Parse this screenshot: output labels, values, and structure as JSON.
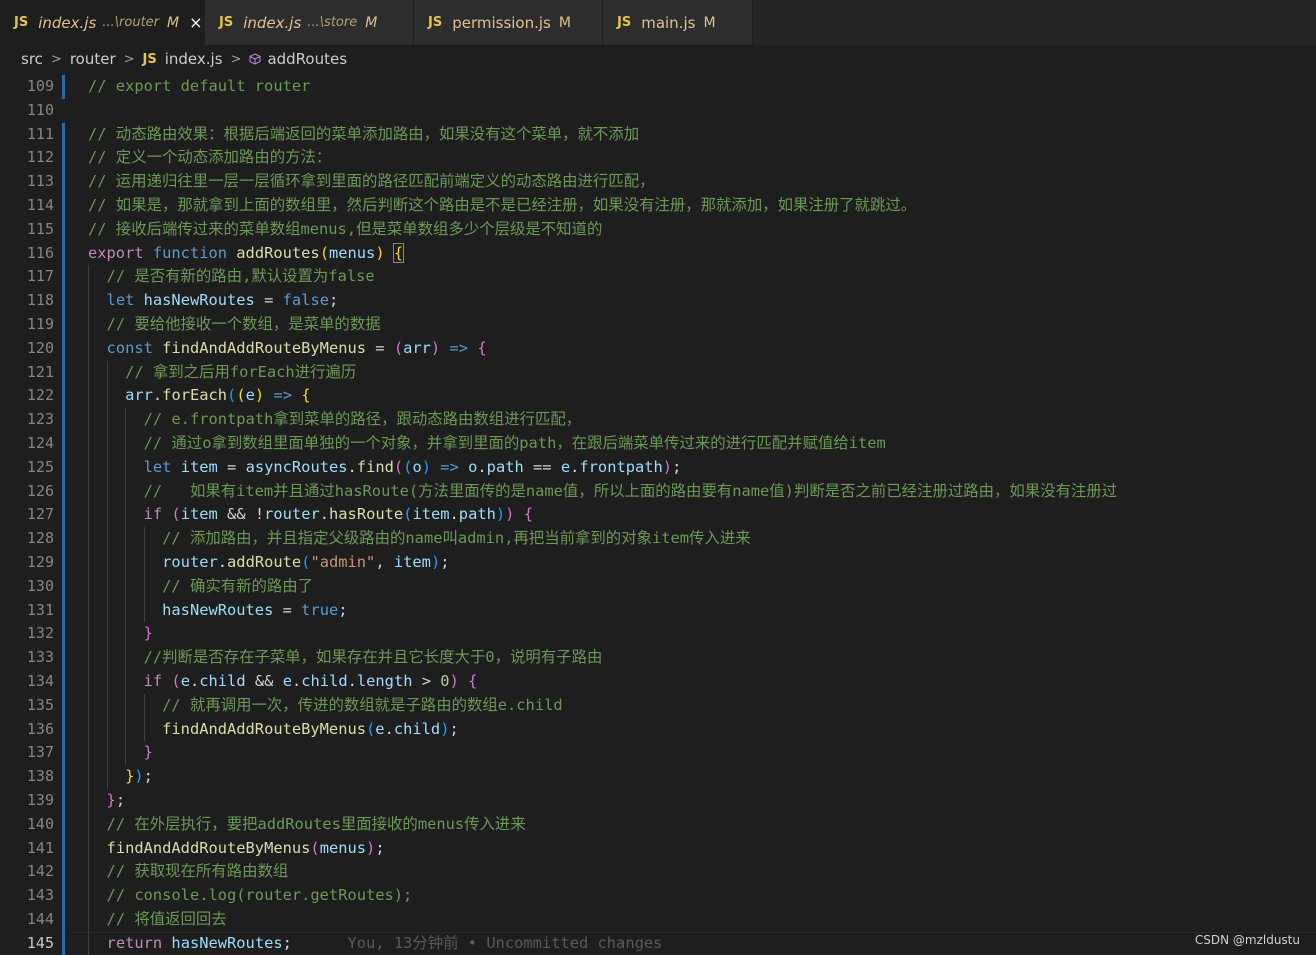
{
  "tabs": [
    {
      "icon": "JS",
      "name": "index.js",
      "path": "...\\router",
      "badge": "M",
      "close": "×",
      "active": true,
      "italic": true
    },
    {
      "icon": "JS",
      "name": "index.js",
      "path": "...\\store",
      "badge": "M",
      "active": false,
      "italic": true
    },
    {
      "icon": "JS",
      "name": "permission.js",
      "path": "",
      "badge": "M",
      "active": false,
      "italic": false
    },
    {
      "icon": "JS",
      "name": "main.js",
      "path": "",
      "badge": "M",
      "active": false,
      "italic": false
    }
  ],
  "breadcrumb": {
    "src": "src",
    "router": "router",
    "js_icon": "JS",
    "file": "index.js",
    "symbol": "addRoutes"
  },
  "lines": [
    {
      "n": "109",
      "t": [
        [
          "c",
          "// export default router"
        ]
      ]
    },
    {
      "n": "110",
      "t": []
    },
    {
      "n": "111",
      "t": [
        [
          "c",
          "// 动态路由效果：根据后端返回的菜单添加路由，如果没有这个菜单，就不添加"
        ]
      ]
    },
    {
      "n": "112",
      "t": [
        [
          "c",
          "// 定义一个动态添加路由的方法："
        ]
      ]
    },
    {
      "n": "113",
      "t": [
        [
          "c",
          "// 运用递归往里一层一层循环拿到里面的路径匹配前端定义的动态路由进行匹配，"
        ]
      ]
    },
    {
      "n": "114",
      "t": [
        [
          "c",
          "// 如果是，那就拿到上面的数组里，然后判断这个路由是不是已经注册，如果没有注册，那就添加，如果注册了就跳过。"
        ]
      ]
    },
    {
      "n": "115",
      "t": [
        [
          "c",
          "// 接收后端传过来的菜单数组menus,但是菜单数组多少个层级是不知道的"
        ]
      ]
    },
    {
      "n": "116",
      "t": [
        [
          "k",
          "export "
        ],
        [
          "s",
          "function "
        ],
        [
          "f",
          "addRoutes"
        ],
        [
          "b1",
          "("
        ],
        [
          "v",
          "menus"
        ],
        [
          "b1",
          ")"
        ],
        [
          "p",
          " "
        ],
        [
          "b1 bracket-box",
          "{"
        ]
      ]
    },
    {
      "n": "117",
      "t": [
        [
          "p",
          "  "
        ],
        [
          "c",
          "// 是否有新的路由,默认设置为false"
        ]
      ]
    },
    {
      "n": "118",
      "t": [
        [
          "p",
          "  "
        ],
        [
          "s",
          "let "
        ],
        [
          "v",
          "hasNewRoutes"
        ],
        [
          "p",
          " = "
        ],
        [
          "s",
          "false"
        ],
        [
          "p",
          ";"
        ]
      ]
    },
    {
      "n": "119",
      "t": [
        [
          "p",
          "  "
        ],
        [
          "c",
          "// 要给他接收一个数组，是菜单的数据"
        ]
      ]
    },
    {
      "n": "120",
      "t": [
        [
          "p",
          "  "
        ],
        [
          "s",
          "const "
        ],
        [
          "f",
          "findAndAddRouteByMenus"
        ],
        [
          "p",
          " = "
        ],
        [
          "b2",
          "("
        ],
        [
          "v",
          "arr"
        ],
        [
          "b2",
          ")"
        ],
        [
          "p",
          " "
        ],
        [
          "s",
          "=>"
        ],
        [
          "p",
          " "
        ],
        [
          "b2",
          "{"
        ]
      ]
    },
    {
      "n": "121",
      "t": [
        [
          "p",
          "    "
        ],
        [
          "c",
          "// 拿到之后用forEach进行遍历"
        ]
      ]
    },
    {
      "n": "122",
      "t": [
        [
          "p",
          "    "
        ],
        [
          "v",
          "arr"
        ],
        [
          "p",
          "."
        ],
        [
          "f",
          "forEach"
        ],
        [
          "b3",
          "("
        ],
        [
          "b1",
          "("
        ],
        [
          "v",
          "e"
        ],
        [
          "b1",
          ")"
        ],
        [
          "p",
          " "
        ],
        [
          "s",
          "=>"
        ],
        [
          "p",
          " "
        ],
        [
          "b1",
          "{"
        ]
      ]
    },
    {
      "n": "123",
      "t": [
        [
          "p",
          "      "
        ],
        [
          "c",
          "// e.frontpath拿到菜单的路径，跟动态路由数组进行匹配，"
        ]
      ]
    },
    {
      "n": "124",
      "t": [
        [
          "p",
          "      "
        ],
        [
          "c",
          "// 通过o拿到数组里面单独的一个对象，并拿到里面的path，在跟后端菜单传过来的进行匹配并赋值给item"
        ]
      ]
    },
    {
      "n": "125",
      "t": [
        [
          "p",
          "      "
        ],
        [
          "s",
          "let "
        ],
        [
          "v",
          "item"
        ],
        [
          "p",
          " = "
        ],
        [
          "v",
          "asyncRoutes"
        ],
        [
          "p",
          "."
        ],
        [
          "f",
          "find"
        ],
        [
          "b2",
          "("
        ],
        [
          "b3",
          "("
        ],
        [
          "v",
          "o"
        ],
        [
          "b3",
          ")"
        ],
        [
          "p",
          " "
        ],
        [
          "s",
          "=>"
        ],
        [
          "p",
          " "
        ],
        [
          "v",
          "o"
        ],
        [
          "p",
          "."
        ],
        [
          "v",
          "path"
        ],
        [
          "p",
          " == "
        ],
        [
          "v",
          "e"
        ],
        [
          "p",
          "."
        ],
        [
          "v",
          "frontpath"
        ],
        [
          "b2",
          ")"
        ],
        [
          "p",
          ";"
        ]
      ]
    },
    {
      "n": "126",
      "t": [
        [
          "p",
          "      "
        ],
        [
          "c",
          "//   如果有item并且通过hasRoute(方法里面传的是name值，所以上面的路由要有name值)判断是否之前已经注册过路由，如果没有注册过"
        ]
      ]
    },
    {
      "n": "127",
      "t": [
        [
          "p",
          "      "
        ],
        [
          "k",
          "if "
        ],
        [
          "b2",
          "("
        ],
        [
          "v",
          "item"
        ],
        [
          "p",
          " && !"
        ],
        [
          "v",
          "router"
        ],
        [
          "p",
          "."
        ],
        [
          "f",
          "hasRoute"
        ],
        [
          "b3",
          "("
        ],
        [
          "v",
          "item"
        ],
        [
          "p",
          "."
        ],
        [
          "v",
          "path"
        ],
        [
          "b3",
          ")"
        ],
        [
          "b2",
          ")"
        ],
        [
          "p",
          " "
        ],
        [
          "b2",
          "{"
        ]
      ]
    },
    {
      "n": "128",
      "t": [
        [
          "p",
          "        "
        ],
        [
          "c",
          "// 添加路由，并且指定父级路由的name叫admin,再把当前拿到的对象item传入进来"
        ]
      ]
    },
    {
      "n": "129",
      "t": [
        [
          "p",
          "        "
        ],
        [
          "v",
          "router"
        ],
        [
          "p",
          "."
        ],
        [
          "f",
          "addRoute"
        ],
        [
          "b3",
          "("
        ],
        [
          "str",
          "\"admin\""
        ],
        [
          "p",
          ", "
        ],
        [
          "v",
          "item"
        ],
        [
          "b3",
          ")"
        ],
        [
          "p",
          ";"
        ]
      ]
    },
    {
      "n": "130",
      "t": [
        [
          "p",
          "        "
        ],
        [
          "c",
          "// 确实有新的路由了"
        ]
      ]
    },
    {
      "n": "131",
      "t": [
        [
          "p",
          "        "
        ],
        [
          "v",
          "hasNewRoutes"
        ],
        [
          "p",
          " = "
        ],
        [
          "s",
          "true"
        ],
        [
          "p",
          ";"
        ]
      ]
    },
    {
      "n": "132",
      "t": [
        [
          "p",
          "      "
        ],
        [
          "b2",
          "}"
        ]
      ]
    },
    {
      "n": "133",
      "t": [
        [
          "p",
          "      "
        ],
        [
          "c",
          "//判断是否存在子菜单，如果存在并且它长度大于0，说明有子路由"
        ]
      ]
    },
    {
      "n": "134",
      "t": [
        [
          "p",
          "      "
        ],
        [
          "k",
          "if "
        ],
        [
          "b2",
          "("
        ],
        [
          "v",
          "e"
        ],
        [
          "p",
          "."
        ],
        [
          "v",
          "child"
        ],
        [
          "p",
          " && "
        ],
        [
          "v",
          "e"
        ],
        [
          "p",
          "."
        ],
        [
          "v",
          "child"
        ],
        [
          "p",
          "."
        ],
        [
          "v",
          "length"
        ],
        [
          "p",
          " > "
        ],
        [
          "n",
          "0"
        ],
        [
          "b2",
          ")"
        ],
        [
          "p",
          " "
        ],
        [
          "b2",
          "{"
        ]
      ]
    },
    {
      "n": "135",
      "t": [
        [
          "p",
          "        "
        ],
        [
          "c",
          "// 就再调用一次，传进的数组就是子路由的数组e.child"
        ]
      ]
    },
    {
      "n": "136",
      "t": [
        [
          "p",
          "        "
        ],
        [
          "f",
          "findAndAddRouteByMenus"
        ],
        [
          "b3",
          "("
        ],
        [
          "v",
          "e"
        ],
        [
          "p",
          "."
        ],
        [
          "v",
          "child"
        ],
        [
          "b3",
          ")"
        ],
        [
          "p",
          ";"
        ]
      ]
    },
    {
      "n": "137",
      "t": [
        [
          "p",
          "      "
        ],
        [
          "b2",
          "}"
        ]
      ]
    },
    {
      "n": "138",
      "t": [
        [
          "p",
          "    "
        ],
        [
          "b1",
          "}"
        ],
        [
          "b3",
          ")"
        ],
        [
          "p",
          ";"
        ]
      ]
    },
    {
      "n": "139",
      "t": [
        [
          "p",
          "  "
        ],
        [
          "b2",
          "}"
        ],
        [
          "p",
          ";"
        ]
      ]
    },
    {
      "n": "140",
      "t": [
        [
          "p",
          "  "
        ],
        [
          "c",
          "// 在外层执行，要把addRoutes里面接收的menus传入进来"
        ]
      ]
    },
    {
      "n": "141",
      "t": [
        [
          "p",
          "  "
        ],
        [
          "f",
          "findAndAddRouteByMenus"
        ],
        [
          "b2",
          "("
        ],
        [
          "v",
          "menus"
        ],
        [
          "b2",
          ")"
        ],
        [
          "p",
          ";"
        ]
      ]
    },
    {
      "n": "142",
      "t": [
        [
          "p",
          "  "
        ],
        [
          "c",
          "// 获取现在所有路由数组"
        ]
      ]
    },
    {
      "n": "143",
      "t": [
        [
          "p",
          "  "
        ],
        [
          "c",
          "// console.log(router.getRoutes);"
        ]
      ]
    },
    {
      "n": "144",
      "t": [
        [
          "p",
          "  "
        ],
        [
          "c",
          "// 将值返回回去"
        ]
      ]
    },
    {
      "n": "145",
      "t": [
        [
          "p",
          "  "
        ],
        [
          "k",
          "return "
        ],
        [
          "v",
          "hasNewRoutes"
        ],
        [
          "p",
          ";"
        ],
        [
          "blame",
          "      You, 13分钟前 • Uncommitted changes"
        ]
      ],
      "current": true
    }
  ],
  "watermark": "CSDN @mzldustu",
  "colors": {
    "background": "#1e1e1e",
    "tabbar": "#252526",
    "comment": "#6a9955",
    "keyword": "#569cd6",
    "function": "#dcdcaa"
  }
}
